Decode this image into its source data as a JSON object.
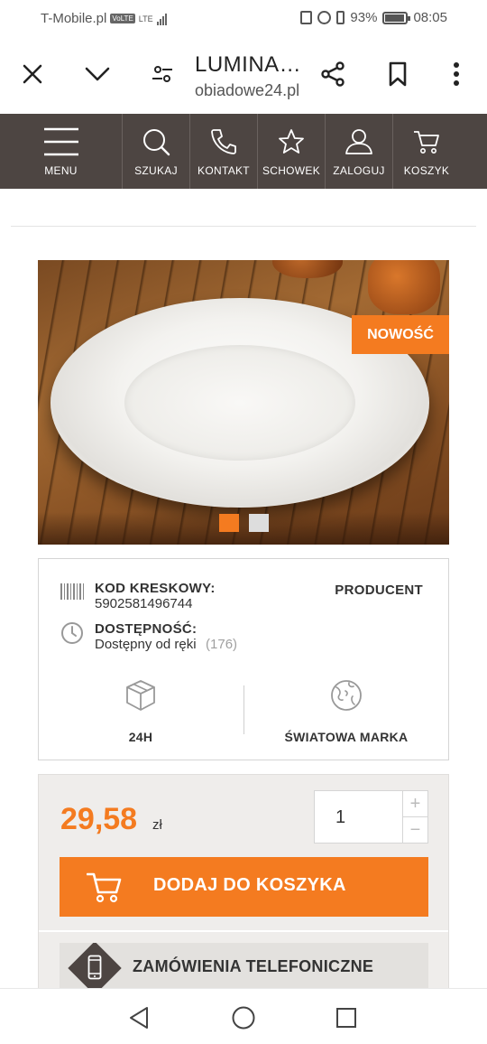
{
  "status_bar": {
    "carrier": "T-Mobile.pl",
    "volte": "VoLTE",
    "network": "LTE",
    "battery": "93%",
    "time": "08:05"
  },
  "browser": {
    "title": "LUMINA…",
    "url": "obiadowe24.pl",
    "icons": [
      "close-icon",
      "chevron-down-icon",
      "tune-icon",
      "share-icon",
      "bookmark-icon",
      "more-vert-icon"
    ]
  },
  "nav": {
    "items": [
      {
        "label": "MENU",
        "icon": "hamburger-icon"
      },
      {
        "label": "SZUKAJ",
        "icon": "search-icon"
      },
      {
        "label": "KONTAKT",
        "icon": "phone-icon"
      },
      {
        "label": "SCHOWEK",
        "icon": "star-icon"
      },
      {
        "label": "ZALOGUJ",
        "icon": "user-icon"
      },
      {
        "label": "KOSZYK",
        "icon": "cart-icon"
      }
    ]
  },
  "gallery": {
    "badge": "NOWOŚĆ",
    "slide_count": 2,
    "active_slide": 1
  },
  "info": {
    "barcode_label": "KOD KRESKOWY:",
    "barcode_value": "5902581496744",
    "producer_label": "PRODUCENT",
    "availability_label": "DOSTĘPNOŚĆ:",
    "availability_value": "Dostępny od ręki",
    "availability_count": "(176)",
    "feature_delivery": "24H",
    "feature_brand": "ŚWIATOWA MARKA"
  },
  "purchase": {
    "price": "29,58",
    "currency": "zł",
    "quantity": "1",
    "plus": "+",
    "minus": "−",
    "add_to_cart": "DODAJ DO KOSZYKA",
    "phone_orders": "ZAMÓWIENIA TELEFONICZNE"
  },
  "colors": {
    "accent": "#f47b20",
    "nav_bg": "#4d4542",
    "price_box_bg": "#efedeb"
  }
}
